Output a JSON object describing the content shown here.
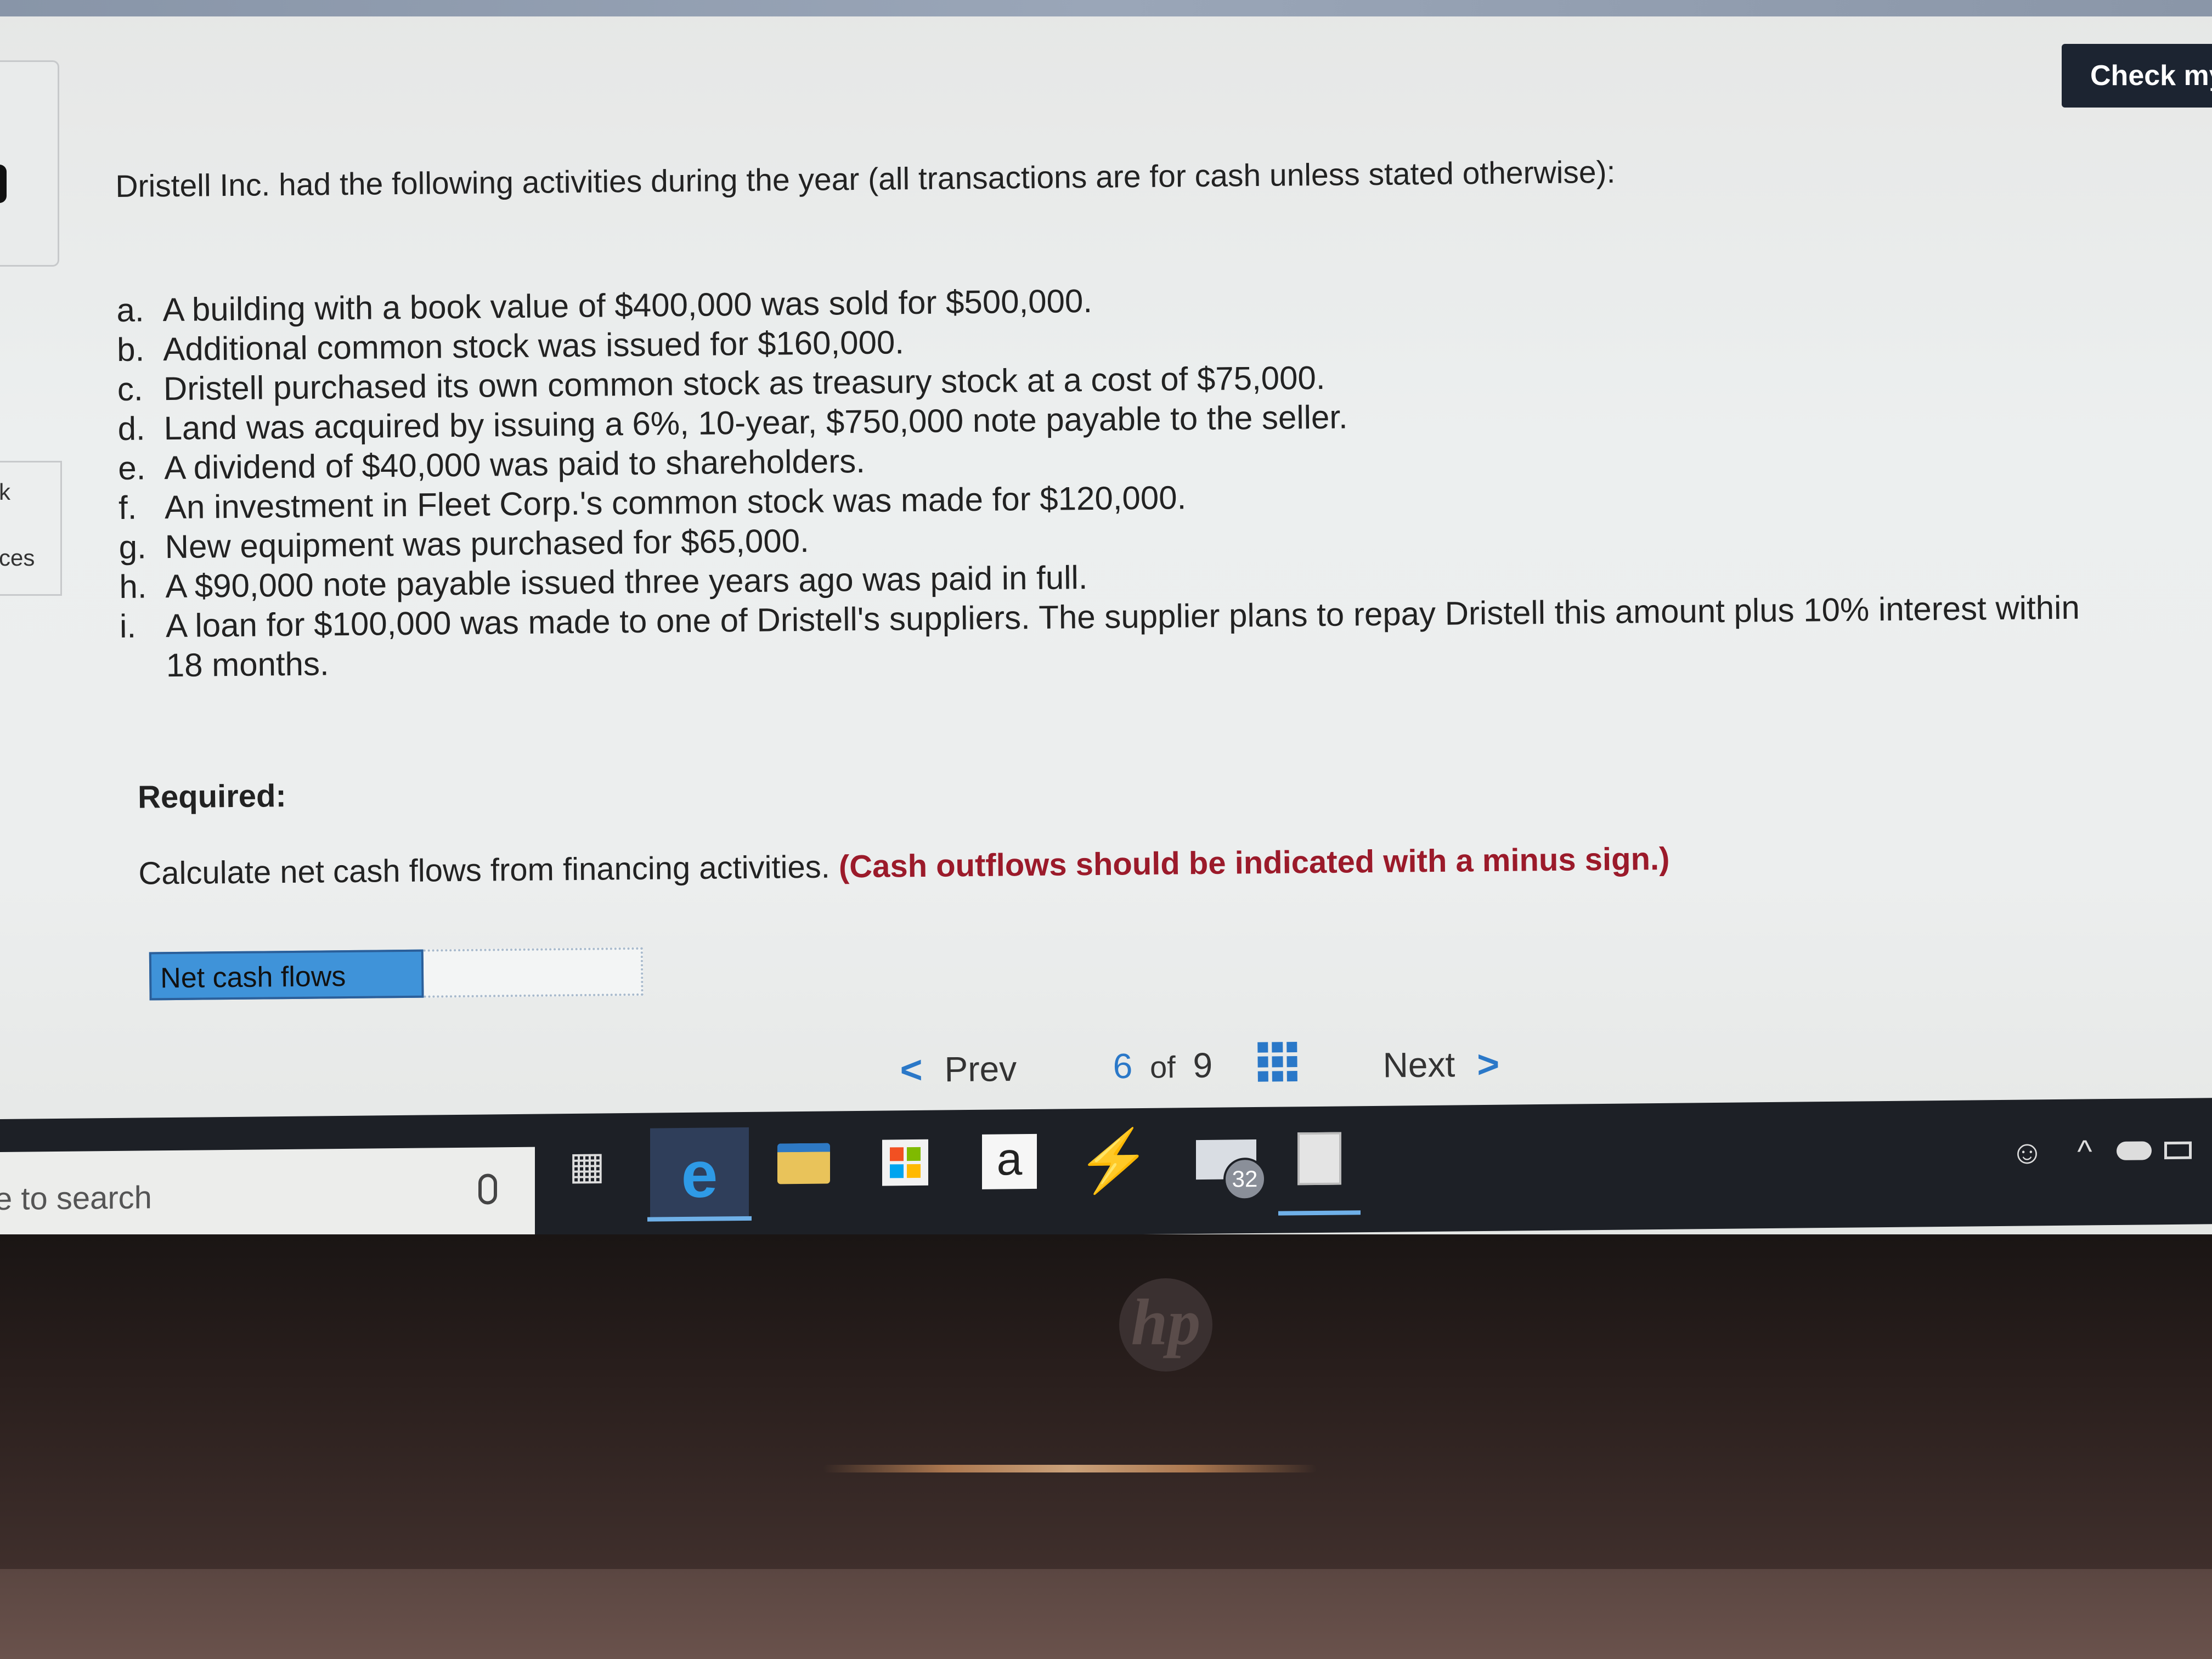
{
  "check_button": {
    "label": "Check my"
  },
  "left_panel": {
    "tab_k": "k",
    "tab_ces": "ces"
  },
  "question": {
    "intro": "Dristell Inc. had the following activities during the year (all transactions are for cash unless stated otherwise):",
    "items": [
      {
        "letter": "a.",
        "text": "A building with a book value of $400,000 was sold for $500,000."
      },
      {
        "letter": "b.",
        "text": "Additional common stock was issued for $160,000."
      },
      {
        "letter": "c.",
        "text": "Dristell purchased its own common stock as treasury stock at a cost of $75,000."
      },
      {
        "letter": "d.",
        "text": "Land was acquired by issuing a 6%, 10-year, $750,000 note payable to the seller."
      },
      {
        "letter": "e.",
        "text": "A dividend of $40,000 was paid to shareholders."
      },
      {
        "letter": "f.",
        "text": "An investment in Fleet Corp.'s common stock was made for $120,000."
      },
      {
        "letter": "g.",
        "text": "New equipment was purchased for $65,000."
      },
      {
        "letter": "h.",
        "text": "A $90,000 note payable issued three years ago was paid in full."
      },
      {
        "letter": "i.",
        "text": "A loan for $100,000 was made to one of Dristell's suppliers. The supplier plans to repay Dristell this amount plus 10% interest within 18 months."
      }
    ],
    "required_label": "Required:",
    "instruction": "Calculate net cash flows from financing activities.",
    "instruction_note": "(Cash outflows should be indicated with a minus sign.)",
    "answer": {
      "label": "Net cash flows",
      "value": ""
    }
  },
  "navigation": {
    "prev_label": "Prev",
    "current_page": "6",
    "of_label": "of",
    "total_pages": "9",
    "next_label": "Next"
  },
  "taskbar": {
    "search_text": "e to search",
    "mail_badge": "32",
    "amazon_glyph": "a"
  },
  "colors": {
    "accent": "#2a78c8",
    "note": "#9b1a2a",
    "answer_label_bg": "#3f93d9",
    "check_button_bg": "#1c2431"
  }
}
